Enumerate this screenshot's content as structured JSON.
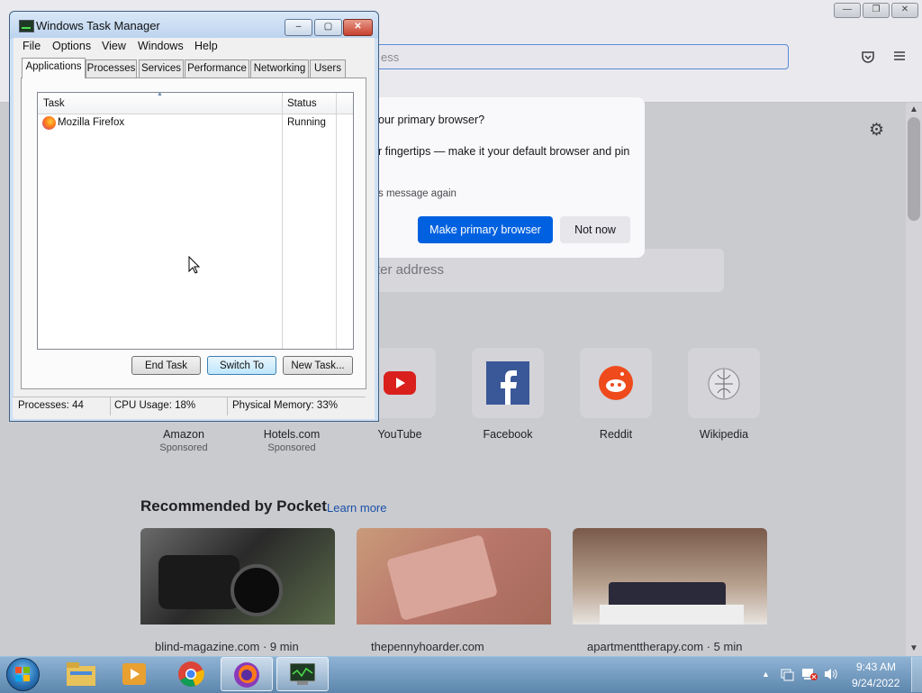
{
  "browser": {
    "url_placeholder_partial": "ess",
    "window_controls": {
      "minimize": "—",
      "restore": "❐",
      "close": "✕"
    },
    "pocket_icon": "pocket-icon",
    "menu_icon": "hamburger-icon",
    "settings_icon": "gear-icon",
    "search_placeholder_partial": "ter address"
  },
  "dialog": {
    "title": "our primary browser?",
    "body": "r fingertips — make it your default browser and pin",
    "checkbox_label": "s message again",
    "primary_button": "Make primary browser",
    "secondary_button": "Not now"
  },
  "top_sites": [
    {
      "name": "Amazon",
      "sub": "Sponsored"
    },
    {
      "name": "Hotels.com",
      "sub": "Sponsored"
    },
    {
      "name": "YouTube",
      "sub": ""
    },
    {
      "name": "Facebook",
      "sub": ""
    },
    {
      "name": "Reddit",
      "sub": ""
    },
    {
      "name": "Wikipedia",
      "sub": ""
    }
  ],
  "pocket": {
    "title": "Recommended by Pocket",
    "learn_more": "Learn more",
    "cards": [
      {
        "source": "blind-magazine.com · 9 min"
      },
      {
        "source": "thepennyhoarder.com"
      },
      {
        "source": "apartmenttherapy.com · 5 min"
      }
    ]
  },
  "task_manager": {
    "title": "Windows Task Manager",
    "menu": [
      "File",
      "Options",
      "View",
      "Windows",
      "Help"
    ],
    "tabs": [
      "Applications",
      "Processes",
      "Services",
      "Performance",
      "Networking",
      "Users"
    ],
    "active_tab": "Applications",
    "columns": {
      "task": "Task",
      "status": "Status"
    },
    "rows": [
      {
        "task": "Mozilla Firefox",
        "status": "Running"
      }
    ],
    "buttons": {
      "end_task": "End Task",
      "switch_to": "Switch To",
      "new_task": "New Task..."
    },
    "status": {
      "processes": "Processes: 44",
      "cpu": "CPU Usage: 18%",
      "memory": "Physical Memory: 33%"
    }
  },
  "taskbar": {
    "time": "9:43 AM",
    "date": "9/24/2022",
    "pinned": [
      "explorer-icon",
      "media-player-icon",
      "chrome-icon",
      "firefox-icon",
      "task-manager-icon"
    ]
  }
}
